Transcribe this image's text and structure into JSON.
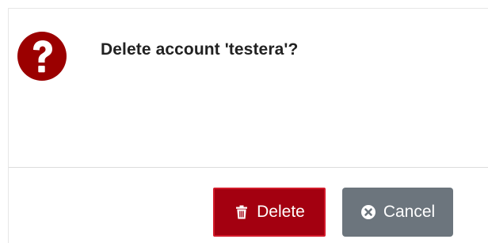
{
  "dialog": {
    "message": "Delete account 'testera'?",
    "icon": "question-circle-icon",
    "colors": {
      "question_icon": "#9b0000",
      "delete_button": "#a30010",
      "cancel_button": "#6c757d"
    }
  },
  "buttons": {
    "delete_label": "Delete",
    "delete_icon": "trash-icon",
    "cancel_label": "Cancel",
    "cancel_icon": "times-circle-icon"
  }
}
